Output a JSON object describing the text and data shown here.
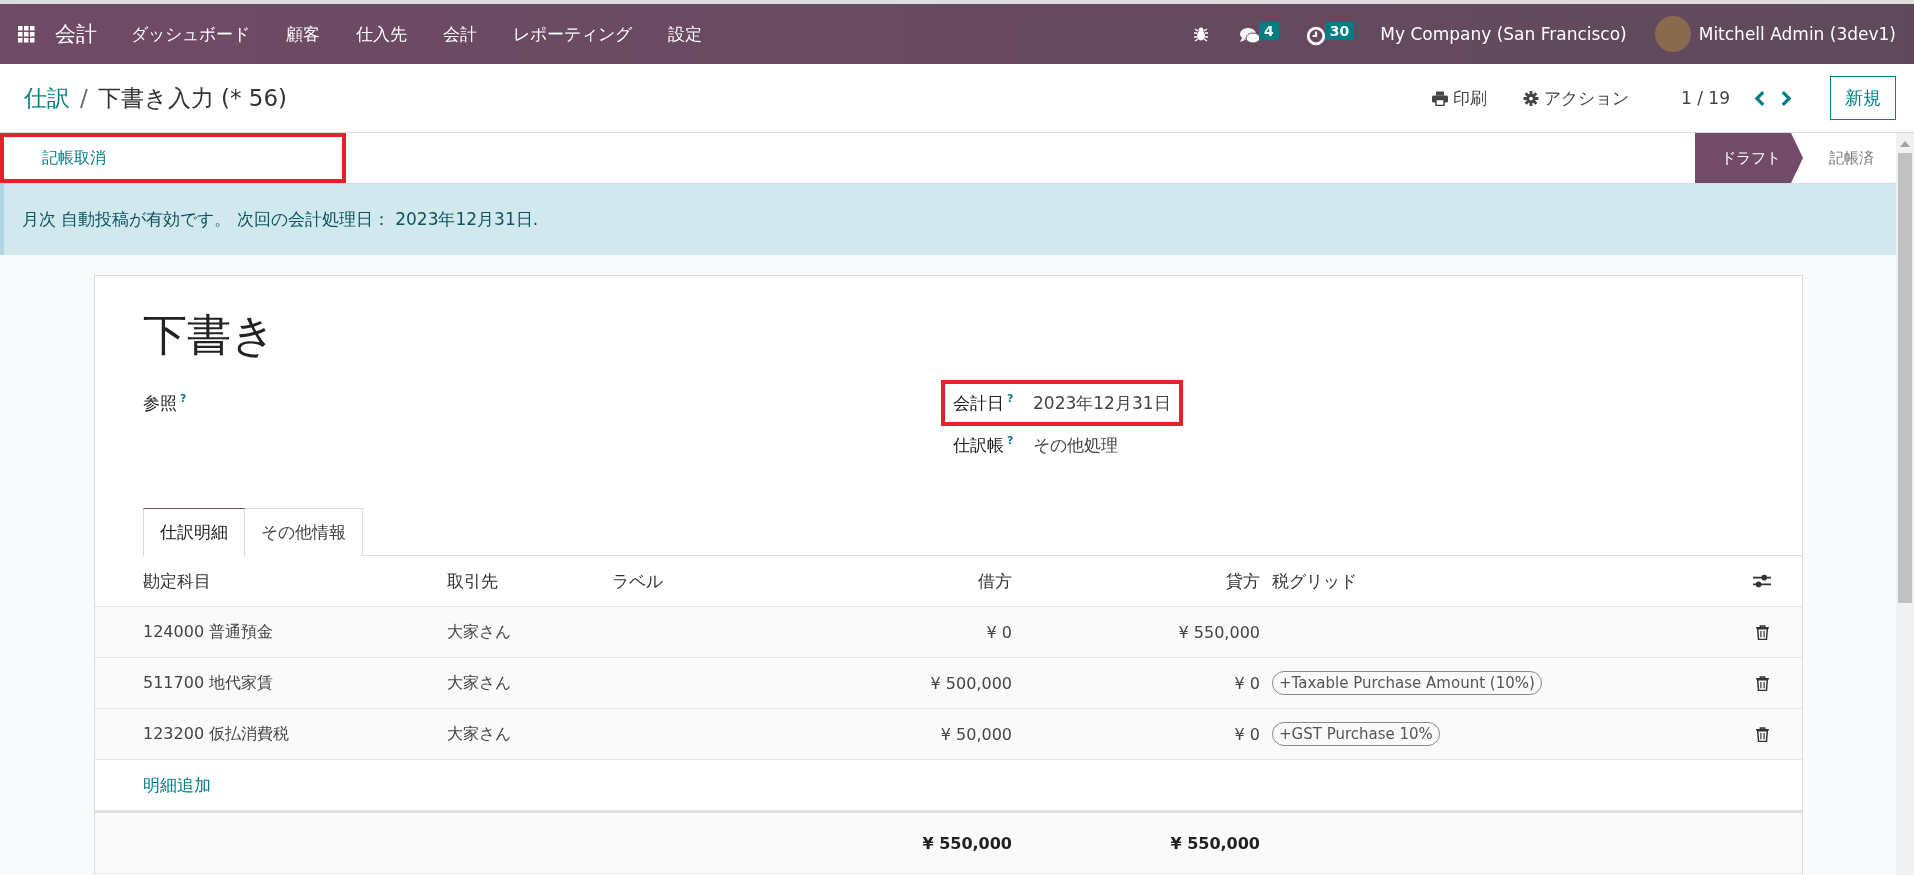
{
  "navbar": {
    "app_name": "会計",
    "menu": [
      "ダッシュボード",
      "顧客",
      "仕入先",
      "会計",
      "レポーティング",
      "設定"
    ],
    "messages_count": "4",
    "activities_count": "30",
    "company": "My Company (San Francisco)",
    "user": "Mitchell Admin (3dev1)"
  },
  "breadcrumb": {
    "parent": "仕訳",
    "separator": "/",
    "current": "下書き入力 (* 56)"
  },
  "control_panel": {
    "print": "印刷",
    "action": "アクション",
    "pager": "1 / 19",
    "new_button": "新規"
  },
  "statusbar": {
    "button": {
      "label": "記帳取消",
      "highlighted": true
    },
    "stages": [
      {
        "label": "ドラフト",
        "selected": true
      },
      {
        "label": "記帳済",
        "selected": false
      }
    ]
  },
  "alert": "月次 自動投稿が有効です。 次回の会計処理日： 2023年12月31日.",
  "form": {
    "title": "下書き",
    "left_fields": [
      {
        "label": "参照",
        "help": "?"
      }
    ],
    "right_fields": [
      {
        "label": "会計日",
        "help": "?",
        "value": "2023年12月31日",
        "highlighted": true
      },
      {
        "label": "仕訳帳",
        "help": "?",
        "value": "その他処理"
      }
    ],
    "tabs": [
      {
        "label": "仕訳明細",
        "selected": true
      },
      {
        "label": "その他情報",
        "selected": false
      }
    ],
    "table": {
      "columns": [
        "勘定科目",
        "取引先",
        "ラベル",
        "借方",
        "貸方",
        "税グリッド"
      ],
      "rows": [
        {
          "account": "124000 普通預金",
          "partner": "大家さん",
          "debit": "¥ 0",
          "credit": "¥ 550,000",
          "tax_tags": []
        },
        {
          "account": "511700 地代家賃",
          "partner": "大家さん",
          "debit": "¥ 500,000",
          "credit": "¥ 0",
          "tax_tags": [
            "+Taxable Purchase Amount (10%)"
          ]
        },
        {
          "account": "123200 仮払消費税",
          "partner": "大家さん",
          "debit": "¥ 50,000",
          "credit": "¥ 0",
          "tax_tags": [
            "+GST Purchase 10%"
          ]
        }
      ],
      "add_line": "明細追加",
      "total_debit": "¥ 550,000",
      "total_credit": "¥ 550,000"
    }
  }
}
